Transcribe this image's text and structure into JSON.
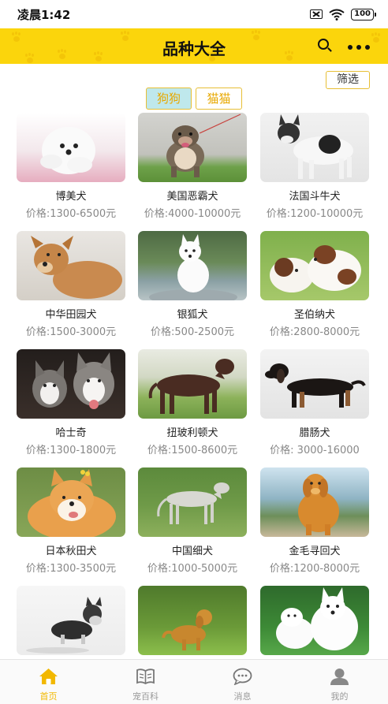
{
  "status_bar": {
    "time": "凌晨1:42",
    "battery": "100"
  },
  "header": {
    "title": "品种大全",
    "search_icon": "search-icon",
    "more_icon": "more-icon",
    "accent_color": "#fbd50c"
  },
  "filter_label": "筛选",
  "tabs": [
    {
      "label": "狗狗",
      "selected": true
    },
    {
      "label": "猫猫",
      "selected": false
    }
  ],
  "breeds": [
    {
      "name": "博美犬",
      "price": "价格:1300-6500元"
    },
    {
      "name": "美国恶霸犬",
      "price": "价格:4000-10000元"
    },
    {
      "name": "法国斗牛犬",
      "price": "价格:1200-10000元"
    },
    {
      "name": "中华田园犬",
      "price": "价格:1500-3000元"
    },
    {
      "name": "银狐犬",
      "price": "价格:500-2500元"
    },
    {
      "name": "圣伯纳犬",
      "price": "价格:2800-8000元"
    },
    {
      "name": "哈士奇",
      "price": "价格:1300-1800元"
    },
    {
      "name": "扭玻利顿犬",
      "price": "价格:1500-8600元"
    },
    {
      "name": "腊肠犬",
      "price": "价格: 3000-16000"
    },
    {
      "name": "日本秋田犬",
      "price": "价格:1300-3500元"
    },
    {
      "name": "中国细犬",
      "price": "价格:1000-5000元"
    },
    {
      "name": "金毛寻回犬",
      "price": "价格:1200-8000元"
    },
    {
      "name": "",
      "price": ""
    },
    {
      "name": "",
      "price": ""
    },
    {
      "name": "",
      "price": ""
    }
  ],
  "nav": [
    {
      "label": "首页",
      "icon": "home-icon",
      "active": true
    },
    {
      "label": "宠百科",
      "icon": "book-icon",
      "active": false
    },
    {
      "label": "消息",
      "icon": "message-icon",
      "active": false
    },
    {
      "label": "我的",
      "icon": "profile-icon",
      "active": false
    }
  ],
  "nav_active_color": "#f2b800"
}
